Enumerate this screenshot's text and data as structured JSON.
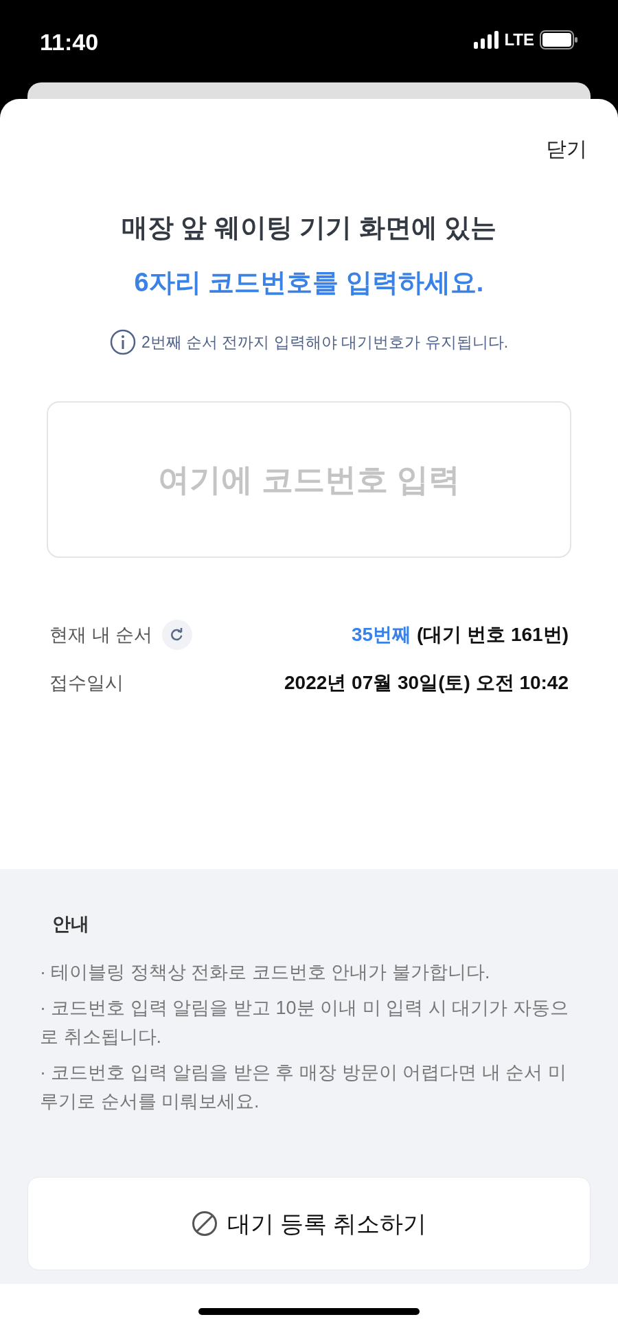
{
  "status_bar": {
    "time": "11:40",
    "network": "LTE"
  },
  "sheet": {
    "close": "닫기",
    "title_line_1": "매장 앞 웨이팅 기기 화면에 있는",
    "title_line_2": "6자리 코드번호를 입력하세요.",
    "info": "2번째 순서 전까지 입력해야 대기번호가 유지됩니다.",
    "code_field": {
      "placeholder": "여기에 코드번호 입력"
    },
    "rows": [
      {
        "kind": "order",
        "label": "현재 내 순서",
        "rank": "35번째",
        "value": "(대기 번호 161번)"
      },
      {
        "kind": "plain",
        "label": "접수일시",
        "value": "2022년 07월 30일(토) 오전 10:42"
      }
    ]
  },
  "notice": {
    "title": "안내",
    "items": [
      "· 테이블링 정책상 전화로 코드번호 안내가 불가합니다.",
      "· 코드번호 입력 알림을 받고 10분 이내 미 입력 시 대기가 자동으로 취소됩니다.",
      "· 코드번호 입력 알림을 받은 후 매장 방문이 어렵다면 내 순서 미루기로 순서를 미뤄보세요."
    ]
  },
  "cancel_button": "대기 등록 취소하기"
}
